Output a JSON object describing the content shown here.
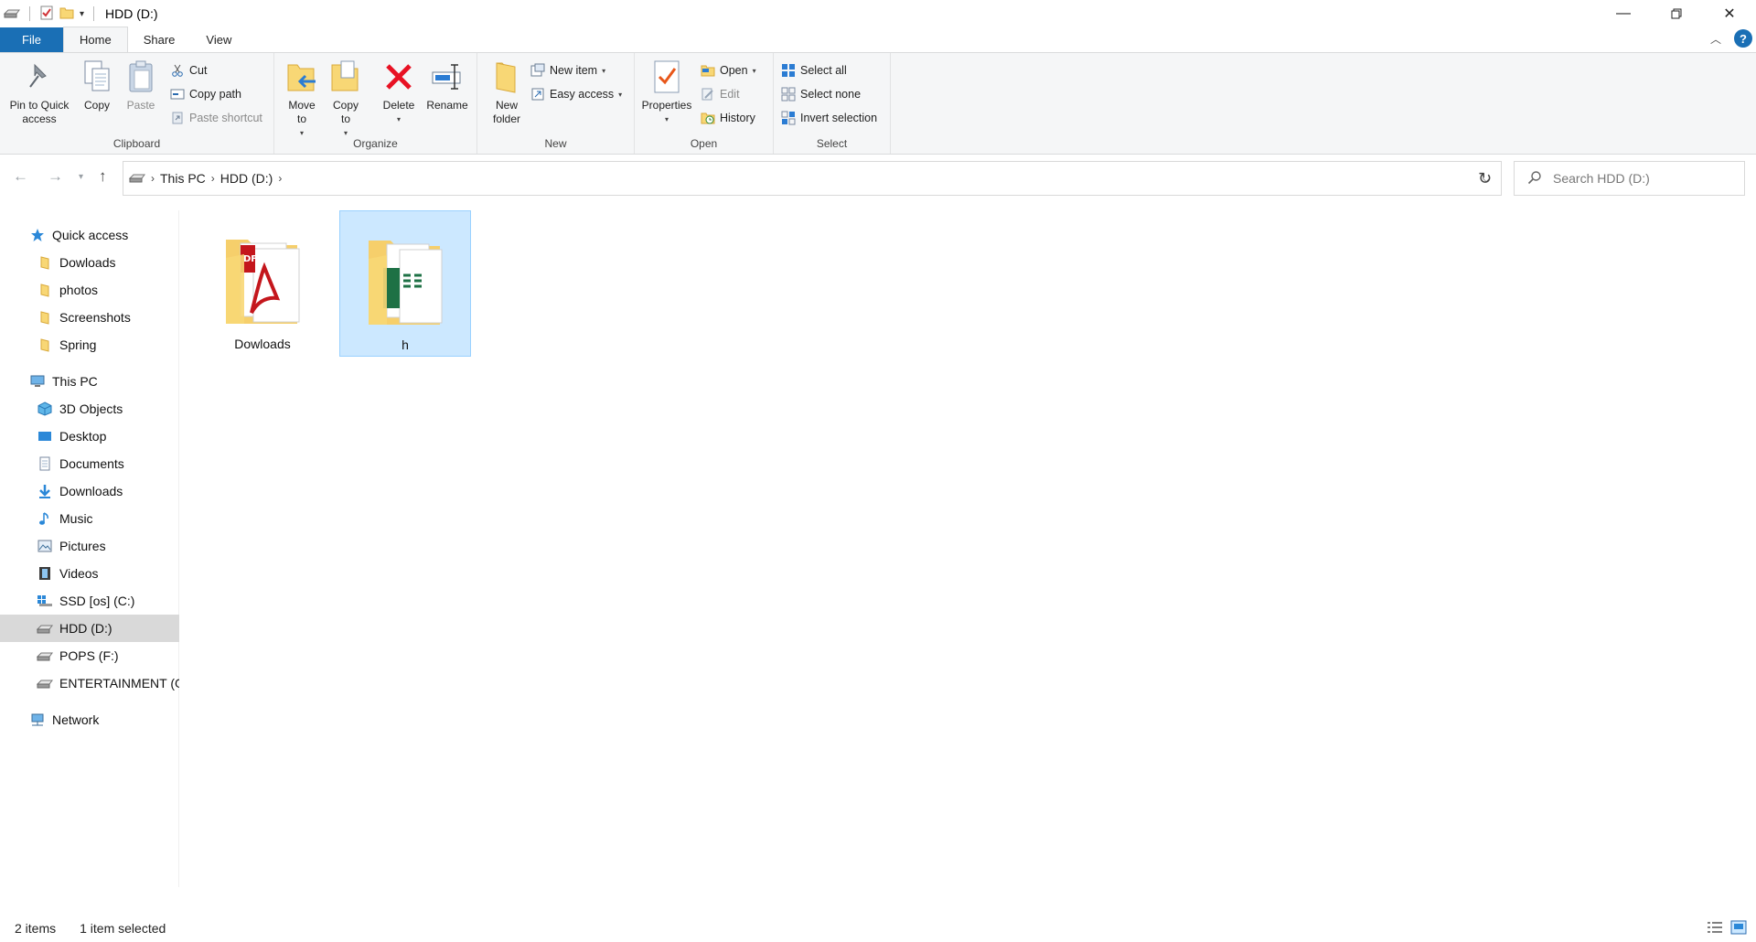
{
  "window": {
    "title": "HDD (D:)"
  },
  "tabs": {
    "file": "File",
    "home": "Home",
    "share": "Share",
    "view": "View"
  },
  "ribbon": {
    "clipboard": {
      "label": "Clipboard",
      "pin": "Pin to Quick access",
      "copy": "Copy",
      "paste": "Paste",
      "cut": "Cut",
      "copy_path": "Copy path",
      "paste_shortcut": "Paste shortcut"
    },
    "organize": {
      "label": "Organize",
      "move_to": "Move to",
      "copy_to": "Copy to",
      "delete": "Delete",
      "rename": "Rename"
    },
    "new": {
      "label": "New",
      "new_folder": "New folder",
      "new_item": "New item",
      "easy_access": "Easy access"
    },
    "open": {
      "label": "Open",
      "properties": "Properties",
      "open": "Open",
      "edit": "Edit",
      "history": "History"
    },
    "select": {
      "label": "Select",
      "select_all": "Select all",
      "select_none": "Select none",
      "invert": "Invert selection"
    }
  },
  "address": {
    "crumbs": [
      "This PC",
      "HDD (D:)"
    ],
    "search_placeholder": "Search HDD (D:)"
  },
  "sidebar": {
    "quick_access": "Quick access",
    "quick_items": [
      "Dowloads",
      "photos",
      "Screenshots",
      "Spring"
    ],
    "this_pc": "This PC",
    "pc_items": [
      "3D Objects",
      "Desktop",
      "Documents",
      "Downloads",
      "Music",
      "Pictures",
      "Videos",
      "SSD [os] (C:)",
      "HDD (D:)",
      "POPS (F:)",
      "ENTERTAINMENT (G:)"
    ],
    "network": "Network"
  },
  "files": [
    {
      "name": "Dowloads",
      "selected": false
    },
    {
      "name": "h",
      "selected": true
    }
  ],
  "status": {
    "count": "2 items",
    "selection": "1 item selected"
  },
  "colors": {
    "accent": "#1a6fb5",
    "selection": "#cce8ff",
    "folder": "#f8d775"
  }
}
